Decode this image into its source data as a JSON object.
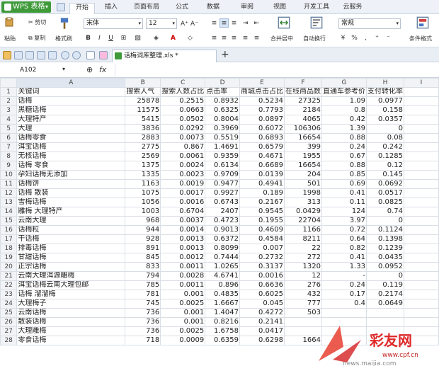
{
  "app": {
    "title": "WPS 表格"
  },
  "tabs": [
    "开始",
    "插入",
    "页面布局",
    "公式",
    "数据",
    "审阅",
    "视图",
    "开发工具",
    "云服务"
  ],
  "active_tab": "开始",
  "ribbon": {
    "cut": "剪切",
    "paste": "粘贴",
    "copy": "复制",
    "format_painter": "格式刷",
    "font_name": "宋体",
    "font_size": "12",
    "merge": "合并居中",
    "wrap": "自动换行",
    "number_format": "常规",
    "conditional": "条件格式"
  },
  "document": {
    "tab_label": "话梅词库整理.xls *"
  },
  "formula_bar": {
    "cell_ref": "A102",
    "fx": "fx"
  },
  "columns": [
    "A",
    "B",
    "C",
    "D",
    "E",
    "F",
    "G",
    "H",
    "I"
  ],
  "rows": [
    [
      "关键词",
      "搜索人气",
      "搜索人数占比",
      "点击率",
      "商城点击占比",
      "在线商品数",
      "直通车参考价",
      "支付转化率",
      ""
    ],
    [
      "话梅",
      "25878",
      "0.2515",
      "0.8932",
      "0.5234",
      "27325",
      "1.09",
      "0.0977",
      ""
    ],
    [
      "黑糖话梅",
      "11575",
      "0.0663",
      "0.6325",
      "0.7793",
      "2184",
      "0.8",
      "0.158",
      ""
    ],
    [
      "大理特产",
      "5415",
      "0.0502",
      "0.8004",
      "0.0897",
      "4065",
      "0.42",
      "0.0357",
      ""
    ],
    [
      "大理",
      "3836",
      "0.0292",
      "0.3969",
      "0.6072",
      "106306",
      "1.39",
      "0",
      ""
    ],
    [
      "话梅零食",
      "2883",
      "0.0073",
      "0.5519",
      "0.6893",
      "16654",
      "0.88",
      "0.08",
      ""
    ],
    [
      "洱宝话梅",
      "2775",
      "0.867",
      "1.4691",
      "0.6579",
      "399",
      "0.24",
      "0.242",
      ""
    ],
    [
      "无核话梅",
      "2569",
      "0.0061",
      "0.9359",
      "0.4671",
      "1955",
      "0.67",
      "0.1285",
      ""
    ],
    [
      "话梅 零食",
      "1375",
      "0.0024",
      "0.6134",
      "0.6689",
      "16654",
      "0.88",
      "0.12",
      ""
    ],
    [
      "孕妇话梅无添加",
      "1335",
      "0.0023",
      "0.9709",
      "0.0139",
      "204",
      "0.85",
      "0.145",
      ""
    ],
    [
      "话梅饼",
      "1163",
      "0.0019",
      "0.9477",
      "0.4941",
      "501",
      "0.69",
      "0.0692",
      ""
    ],
    [
      "话梅 散装",
      "1075",
      "0.0017",
      "0.9927",
      "0.189",
      "1998",
      "0.41",
      "0.0517",
      ""
    ],
    [
      "雪梅话梅",
      "1056",
      "0.0016",
      "0.6743",
      "0.2167",
      "313",
      "0.11",
      "0.0825",
      ""
    ],
    [
      "雕梅 大理特产",
      "1003",
      "0.6704",
      "2407",
      "0.9545",
      "0.0429",
      "124",
      "0.74",
      ""
    ],
    [
      "云南大理",
      "968",
      "0.0037",
      "0.4723",
      "0.1955",
      "22704",
      "3.97",
      "0",
      ""
    ],
    [
      "话梅粒",
      "944",
      "0.0014",
      "0.9013",
      "0.4609",
      "1166",
      "0.72",
      "0.1124",
      ""
    ],
    [
      "干话梅",
      "928",
      "0.0013",
      "0.6372",
      "0.4584",
      "8211",
      "0.64",
      "0.1398",
      ""
    ],
    [
      "排毒话梅",
      "891",
      "0.0013",
      "0.8099",
      "0.007",
      "22",
      "0.82",
      "0.1239",
      ""
    ],
    [
      "甘甜话梅",
      "845",
      "0.0012",
      "0.7444",
      "0.2732",
      "272",
      "0.41",
      "0.0435",
      ""
    ],
    [
      "正宗话梅",
      "833",
      "0.0011",
      "1.0265",
      "0.3137",
      "1320",
      "1.33",
      "0.0952",
      ""
    ],
    [
      "云南大理洱源雕梅",
      "794",
      "0.0028",
      "4.6741",
      "0.0016",
      "12",
      "-",
      "0",
      ""
    ],
    [
      "洱宝话梅云南大理包邮",
      "785",
      "0.0011",
      "0.896",
      "0.6636",
      "276",
      "0.24",
      "0.119",
      ""
    ],
    [
      "话梅 溜溜梅",
      "781",
      "0.001",
      "0.4835",
      "0.6025",
      "432",
      "0.17",
      "0.2174",
      ""
    ],
    [
      "大理梅子",
      "745",
      "0.0025",
      "1.6667",
      "0.045",
      "777",
      "0.4",
      "0.0649",
      ""
    ],
    [
      "云南话梅",
      "736",
      "0.001",
      "1.4047",
      "0.4272",
      "503",
      "",
      "",
      " "
    ],
    [
      "散装话梅",
      "736",
      "0.001",
      "0.8216",
      "0.2141",
      "",
      "",
      "",
      ""
    ],
    [
      "大理雕梅",
      "736",
      "0.0025",
      "1.6758",
      "0.0417",
      "",
      "",
      "",
      ""
    ],
    [
      "零食话梅",
      "718",
      "0.0009",
      "0.6359",
      "0.6298",
      "1664",
      "",
      "",
      ""
    ]
  ],
  "watermark": {
    "brand": "彩友网",
    "url": "www.cpf.cn",
    "site": "news.maijia.com"
  }
}
